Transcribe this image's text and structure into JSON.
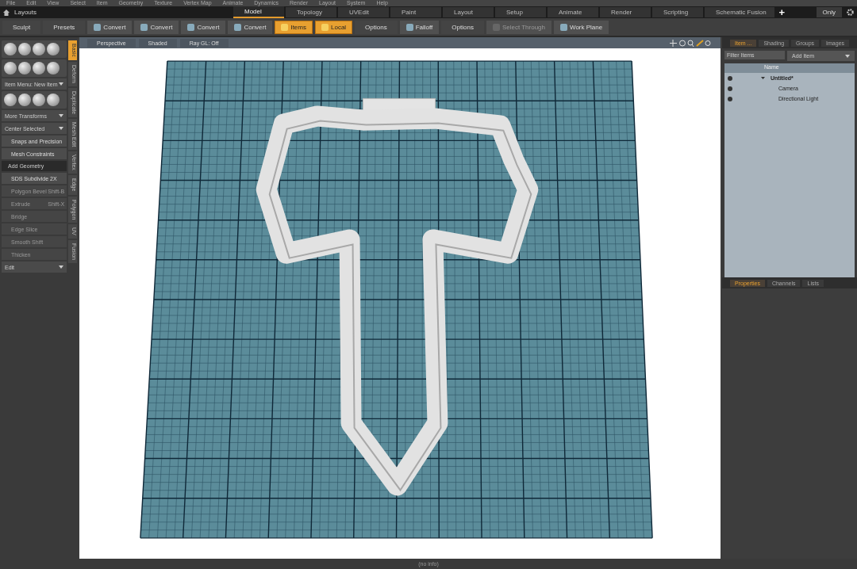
{
  "menu": [
    "File",
    "Edit",
    "View",
    "Select",
    "Item",
    "Geometry",
    "Texture",
    "Vertex Map",
    "Animate",
    "Dynamics",
    "Render",
    "Layout",
    "System",
    "Help"
  ],
  "layouts_label": "Layouts",
  "layout_tabs": [
    {
      "label": "Model",
      "selected": true
    },
    {
      "label": "Topology",
      "selected": false
    },
    {
      "label": "UVEdit",
      "selected": false
    },
    {
      "label": "Paint",
      "selected": false
    },
    {
      "label": "Layout",
      "selected": false
    },
    {
      "label": "Setup",
      "selected": false
    },
    {
      "label": "Animate",
      "selected": false
    },
    {
      "label": "Render",
      "selected": false
    },
    {
      "label": "Scripting",
      "selected": false
    },
    {
      "label": "Schematic Fusion",
      "selected": false
    }
  ],
  "add_tab": "+",
  "only_label": "Only",
  "toolbar": [
    {
      "label": "Sculpt",
      "kind": "plain",
      "selected": false,
      "disabled": false
    },
    {
      "label": "Presets",
      "kind": "plain",
      "selected": false,
      "disabled": false
    },
    {
      "label": "Convert",
      "kind": "icon",
      "selected": false,
      "disabled": false
    },
    {
      "label": "Convert",
      "kind": "icon",
      "selected": false,
      "disabled": false
    },
    {
      "label": "Convert",
      "kind": "icon",
      "selected": false,
      "disabled": false
    },
    {
      "label": "Convert",
      "kind": "icon",
      "selected": false,
      "disabled": false
    },
    {
      "label": "Items",
      "kind": "icon",
      "selected": true,
      "disabled": false
    },
    {
      "label": "Local",
      "kind": "icon",
      "selected": true,
      "disabled": false
    },
    {
      "label": "Options",
      "kind": "plain",
      "selected": false,
      "disabled": false
    },
    {
      "label": "Falloff",
      "kind": "icon",
      "selected": false,
      "disabled": false
    },
    {
      "label": "Options",
      "kind": "plain",
      "selected": false,
      "disabled": false
    },
    {
      "label": "Select Through",
      "kind": "icon",
      "selected": false,
      "disabled": true
    },
    {
      "label": "Work Plane",
      "kind": "icon",
      "selected": false,
      "disabled": false
    }
  ],
  "tool_panel": [
    {
      "kind": "icons"
    },
    {
      "kind": "icons"
    },
    {
      "kind": "dropdown",
      "label": "Item Menu: New Item"
    },
    {
      "kind": "icons"
    },
    {
      "kind": "dropdown",
      "label": "More Transforms"
    },
    {
      "kind": "dropdown",
      "label": "Center Selected"
    },
    {
      "kind": "tool",
      "label": "Snaps and Precision",
      "disabled": false
    },
    {
      "kind": "tool",
      "label": "Mesh Constraints",
      "disabled": false
    },
    {
      "kind": "header",
      "label": "Add Geometry"
    },
    {
      "kind": "tool",
      "label": "SDS Subdivide 2X",
      "disabled": false
    },
    {
      "kind": "tool",
      "label": "Polygon Bevel",
      "shortcut": "Shift-B",
      "disabled": true
    },
    {
      "kind": "tool",
      "label": "Extrude",
      "shortcut": "Shift-X",
      "disabled": true
    },
    {
      "kind": "tool",
      "label": "Bridge",
      "disabled": true
    },
    {
      "kind": "tool",
      "label": "Edge Slice",
      "disabled": true
    },
    {
      "kind": "tool",
      "label": "Smooth Shift",
      "disabled": true
    },
    {
      "kind": "tool",
      "label": "Thicken",
      "disabled": true
    },
    {
      "kind": "dropdown",
      "label": "Edit"
    }
  ],
  "side_tabs": [
    {
      "label": "Basic",
      "selected": true
    },
    {
      "label": "Deform",
      "selected": false
    },
    {
      "label": "Duplicate",
      "selected": false
    },
    {
      "label": "Mesh Edit",
      "selected": false
    },
    {
      "label": "Vertex",
      "selected": false
    },
    {
      "label": "Edge",
      "selected": false
    },
    {
      "label": "Polygon",
      "selected": false
    },
    {
      "label": "UV",
      "selected": false
    },
    {
      "label": "Fusion",
      "selected": false
    }
  ],
  "viewport": {
    "buttons": [
      "Perspective",
      "Shaded",
      "Ray GL: Off"
    ]
  },
  "item_tabs": [
    {
      "label": "Item ...",
      "selected": true
    },
    {
      "label": "Shading",
      "selected": false
    },
    {
      "label": "Groups",
      "selected": false
    },
    {
      "label": "Images",
      "selected": false
    }
  ],
  "filter": {
    "placeholder": "Filter Items"
  },
  "add_item": "Add Item",
  "name_column": "Name",
  "tree": [
    {
      "label": "Untitled*",
      "expanded": true,
      "children": [
        {
          "label": "Camera"
        },
        {
          "label": "Directional Light"
        }
      ]
    }
  ],
  "props_tabs": [
    {
      "label": "Properties",
      "selected": true
    },
    {
      "label": "Channels",
      "selected": false
    },
    {
      "label": "Lists",
      "selected": false
    }
  ],
  "status_bar": "(no info)"
}
